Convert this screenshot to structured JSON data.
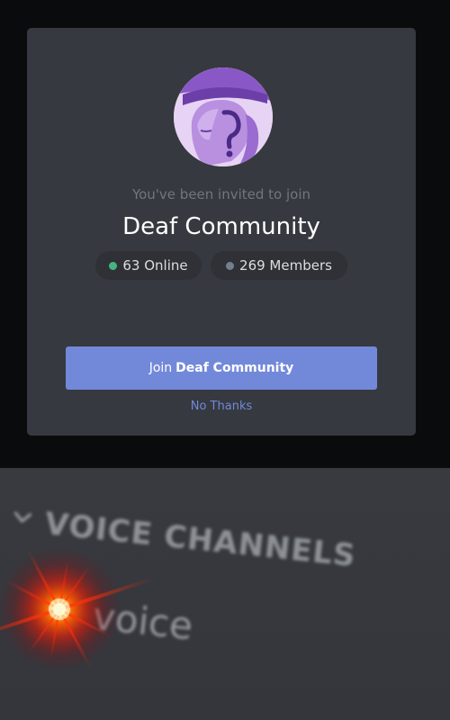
{
  "invite": {
    "subtitle": "You've been invited to join",
    "server_name": "Deaf Community",
    "online": {
      "count_text": "63 Online",
      "dot_color": "#43b581"
    },
    "members": {
      "count_text": "269 Members",
      "dot_color": "#747f8d"
    },
    "join_button": {
      "prefix": "Join",
      "server_name": "Deaf Community",
      "color": "#7289da"
    },
    "decline_label": "No Thanks",
    "server_icon": "ear-question-icon"
  },
  "channel_list": {
    "category_label": "VOICE CHANNELS",
    "category_icon": "chevron-down-icon",
    "channel_name": "voice"
  },
  "effects": {
    "lens_flare_color": "#ff2200"
  }
}
